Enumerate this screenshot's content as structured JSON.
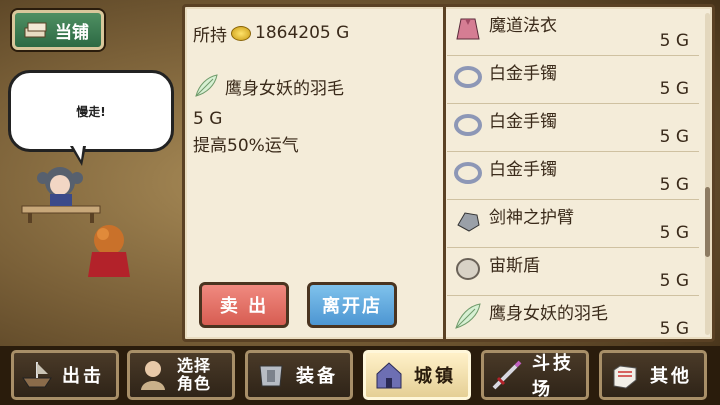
{
  "pawn_tab": {
    "label": "当铺",
    "icon": "scroll-pile-icon"
  },
  "bubble": {
    "text": "慢走!"
  },
  "panel": {
    "money_prefix": "所持",
    "money_value": "1864205 G",
    "selected": {
      "name": "鹰身女妖的羽毛",
      "price": "5 G",
      "effect": "提高50%运气",
      "icon": "feather-icon"
    },
    "sell_label": "卖 出",
    "leave_label": "离开店"
  },
  "items": [
    {
      "name": "魔道法衣",
      "price": "5 G",
      "icon": "robe-icon"
    },
    {
      "name": "白金手镯",
      "price": "5 G",
      "icon": "bracelet-icon"
    },
    {
      "name": "白金手镯",
      "price": "5 G",
      "icon": "bracelet-icon"
    },
    {
      "name": "白金手镯",
      "price": "5 G",
      "icon": "bracelet-icon"
    },
    {
      "name": "剑神之护臂",
      "price": "5 G",
      "icon": "gauntlet-icon"
    },
    {
      "name": "宙斯盾",
      "price": "5 G",
      "icon": "shield-icon"
    },
    {
      "name": "鹰身女妖的羽毛",
      "price": "5 G",
      "icon": "feather-icon"
    }
  ],
  "nav": [
    {
      "label": "出击",
      "icon": "ship-icon",
      "active": false
    },
    {
      "label": "选择角色",
      "icon": "character-icon",
      "active": false
    },
    {
      "label": "装备",
      "icon": "armor-icon",
      "active": false
    },
    {
      "label": "城镇",
      "icon": "town-icon",
      "active": true
    },
    {
      "label": "斗技场",
      "icon": "sword-icon",
      "active": false
    },
    {
      "label": "其他",
      "icon": "glove-icon",
      "active": false
    }
  ],
  "colors": {
    "panel_bg": "#f4ecd9",
    "sell_red": "#e0685d",
    "leave_blue": "#5ea4db",
    "tab_green": "#3b7d52"
  }
}
